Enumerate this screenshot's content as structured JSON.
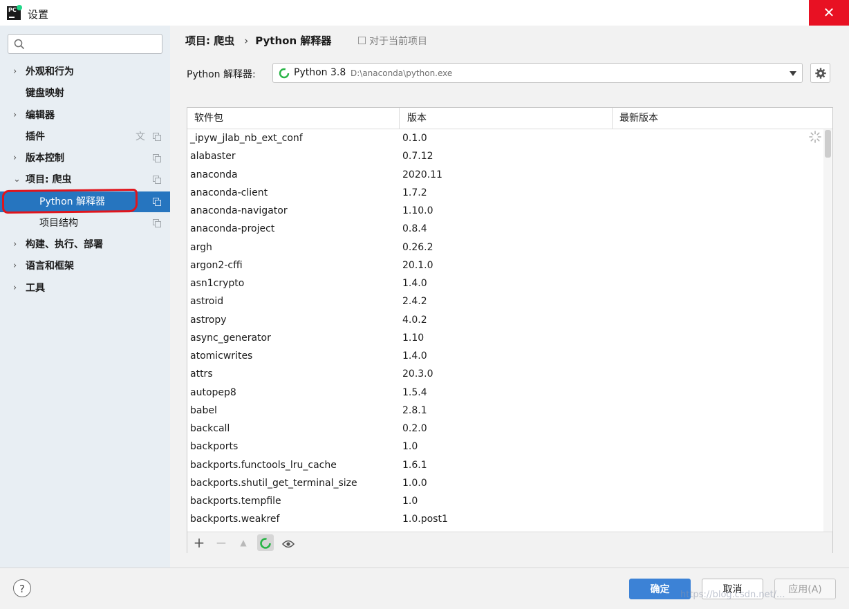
{
  "window": {
    "title": "设置",
    "logo_text": "PC",
    "close_glyph": "✕"
  },
  "sidebar": {
    "search_placeholder": "",
    "items": [
      {
        "label": "外观和行为",
        "arrow": "›"
      },
      {
        "label": "键盘映射",
        "arrow": ""
      },
      {
        "label": "编辑器",
        "arrow": "›"
      },
      {
        "label": "插件",
        "arrow": ""
      },
      {
        "label": "版本控制",
        "arrow": "›"
      },
      {
        "label": "项目: 爬虫",
        "arrow": "⌄"
      },
      {
        "label": "Python 解释器",
        "arrow": ""
      },
      {
        "label": "项目结构",
        "arrow": ""
      },
      {
        "label": "构建、执行、部署",
        "arrow": "›"
      },
      {
        "label": "语言和框架",
        "arrow": "›"
      },
      {
        "label": "工具",
        "arrow": "›"
      }
    ],
    "translate_glyph": "文",
    "selected_index": 6
  },
  "breadcrumb": {
    "project": "项目: 爬虫",
    "separator": "›",
    "page": "Python 解释器",
    "scope": "对于当前项目"
  },
  "interpreter": {
    "label": "Python 解释器:",
    "name": "Python 3.8",
    "path": "D:\\anaconda\\python.exe"
  },
  "packages": {
    "columns": [
      "软件包",
      "版本",
      "最新版本"
    ],
    "rows": [
      [
        "_ipyw_jlab_nb_ext_conf",
        "0.1.0"
      ],
      [
        "alabaster",
        "0.7.12"
      ],
      [
        "anaconda",
        "2020.11"
      ],
      [
        "anaconda-client",
        "1.7.2"
      ],
      [
        "anaconda-navigator",
        "1.10.0"
      ],
      [
        "anaconda-project",
        "0.8.4"
      ],
      [
        "argh",
        "0.26.2"
      ],
      [
        "argon2-cffi",
        "20.1.0"
      ],
      [
        "asn1crypto",
        "1.4.0"
      ],
      [
        "astroid",
        "2.4.2"
      ],
      [
        "astropy",
        "4.0.2"
      ],
      [
        "async_generator",
        "1.10"
      ],
      [
        "atomicwrites",
        "1.4.0"
      ],
      [
        "attrs",
        "20.3.0"
      ],
      [
        "autopep8",
        "1.5.4"
      ],
      [
        "babel",
        "2.8.1"
      ],
      [
        "backcall",
        "0.2.0"
      ],
      [
        "backports",
        "1.0"
      ],
      [
        "backports.functools_lru_cache",
        "1.6.1"
      ],
      [
        "backports.shutil_get_terminal_size",
        "1.0.0"
      ],
      [
        "backports.tempfile",
        "1.0"
      ],
      [
        "backports.weakref",
        "1.0.post1"
      ]
    ],
    "toolbar": {
      "add": "+",
      "remove": "−",
      "upgrade": "▲"
    }
  },
  "footer": {
    "help": "?",
    "ok": "确定",
    "cancel": "取消",
    "apply": "应用(A)",
    "watermark": "https://blog.csdn.net/..."
  },
  "colors": {
    "selection": "#2675bf",
    "primary_button": "#3c82d6",
    "close_button": "#e81123",
    "spinner": "#28b446",
    "annotation": "#e0151c"
  }
}
